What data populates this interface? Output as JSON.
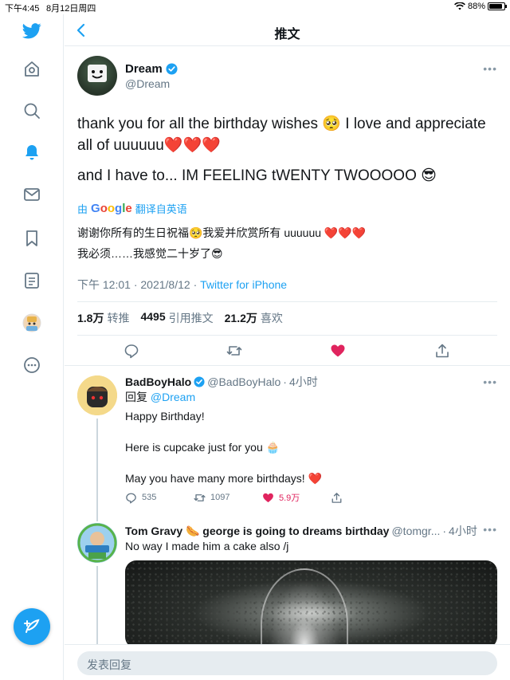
{
  "status_bar": {
    "time": "下午4:45",
    "date": "8月12日周四",
    "battery": "88%",
    "battery_level": 0.88
  },
  "header": {
    "title": "推文"
  },
  "sidebar": {
    "items": [
      {
        "icon": "twitter-logo-icon"
      },
      {
        "icon": "home-icon"
      },
      {
        "icon": "explore-icon"
      },
      {
        "icon": "notifications-icon"
      },
      {
        "icon": "messages-icon"
      },
      {
        "icon": "bookmarks-icon"
      },
      {
        "icon": "lists-icon"
      },
      {
        "icon": "profile-avatar-icon"
      },
      {
        "icon": "more-icon"
      }
    ],
    "compose_icon": "compose-tweet-icon"
  },
  "tweet": {
    "name": "Dream",
    "handle": "@Dream",
    "text_line1": "thank you for all the birthday wishes 🥺 I love and appreciate all of uuuuuu❤️❤️❤️",
    "text_line2": "and I have to... IM FEELING tWENTY TWOOOOO 😎",
    "translate_prefix": "由",
    "translate_brand": "Google",
    "translate_suffix": "翻译自英语",
    "translation_line1": "谢谢你所有的生日祝福🥺我爱并欣赏所有 uuuuuu ❤️❤️❤️",
    "translation_line2": "我必须……我感觉二十岁了😎",
    "time": "下午 12:01",
    "date": "2021/8/12",
    "source": "Twitter for iPhone",
    "retweets_count": "1.8万",
    "retweets_label": "转推",
    "quotes_count": "4495",
    "quotes_label": "引用推文",
    "likes_count": "21.2万",
    "likes_label": "喜欢"
  },
  "replies": [
    {
      "name": "BadBoyHalo",
      "handle": "@BadBoyHalo",
      "time": "4小时",
      "reply_prefix": "回复",
      "reply_to": "@Dream",
      "line1": "Happy Birthday!",
      "line2": "Here is cupcake just for you 🧁",
      "line3": "May you have many more birthdays! ❤️",
      "reply_count": "535",
      "retweet_count": "1097",
      "like_count": "5.9万"
    },
    {
      "name": "Tom Gravy 🌭 george is going to dreams birthday",
      "handle": "@tomgr...",
      "time": "4小时",
      "text": "No way I made him a cake also /j"
    }
  ],
  "reply_bar": {
    "placeholder": "发表回复"
  },
  "colors": {
    "accent": "#1da1f2",
    "like": "#e0245e",
    "text": "#14171a",
    "secondary": "#657786",
    "border": "#e6ecf0"
  }
}
